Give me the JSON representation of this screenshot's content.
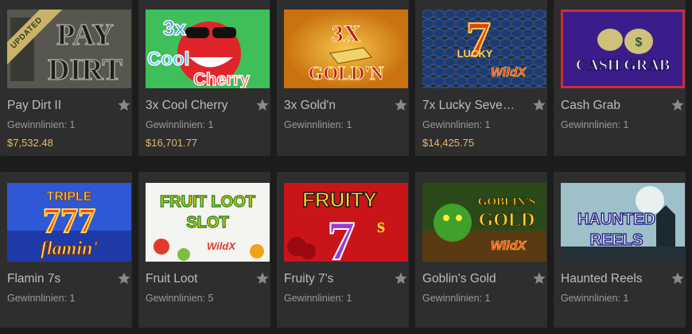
{
  "games": [
    {
      "id": "pay-dirt-ii",
      "title": "Pay Dirt II",
      "lines": "Gewinnlinien: 1",
      "jackpot": "$7,532.48",
      "badge": "UPDATED",
      "art_text": [
        "PAY",
        "DIRT"
      ]
    },
    {
      "id": "3x-cool-cherry",
      "title": "3x Cool Cherry",
      "lines": "Gewinnlinien: 1",
      "jackpot": "$16,701.77",
      "art_text": [
        "3x",
        "Cool",
        "Cherry"
      ]
    },
    {
      "id": "3x-goldn",
      "title": "3x Gold'n",
      "lines": "Gewinnlinien: 1",
      "jackpot": "",
      "art_text": [
        "3X",
        "GOLD'N"
      ]
    },
    {
      "id": "7x-lucky-sevens",
      "title": "7x Lucky Seve…",
      "lines": "Gewinnlinien: 1",
      "jackpot": "$14,425.75",
      "art_text": [
        "7",
        "LUCKY",
        "WildX"
      ]
    },
    {
      "id": "cash-grab",
      "title": "Cash Grab",
      "lines": "Gewinnlinien: 1",
      "jackpot": "",
      "art_text": [
        "CASH GRAB"
      ]
    },
    {
      "id": "flamin-7s",
      "title": "Flamin 7s",
      "lines": "Gewinnlinien: 1",
      "jackpot": "",
      "art_text": [
        "TRIPLE",
        "777",
        "flamin'"
      ]
    },
    {
      "id": "fruit-loot",
      "title": "Fruit Loot",
      "lines": "Gewinnlinien: 5",
      "jackpot": "",
      "art_text": [
        "FRUIT LOOT",
        "SLOT",
        "WildX"
      ]
    },
    {
      "id": "fruity-7s",
      "title": "Fruity 7's",
      "lines": "Gewinnlinien: 1",
      "jackpot": "",
      "art_text": [
        "FRUITY",
        "7",
        "s"
      ]
    },
    {
      "id": "goblins-gold",
      "title": "Goblin's Gold",
      "lines": "Gewinnlinien: 1",
      "jackpot": "",
      "art_text": [
        "GOBLIN'S",
        "GOLD",
        "WildX"
      ]
    },
    {
      "id": "haunted-reels",
      "title": "Haunted Reels",
      "lines": "Gewinnlinien: 1",
      "jackpot": "",
      "art_text": [
        "HAUNTED",
        "REELS"
      ]
    }
  ],
  "icons": {
    "favorite": "star-icon"
  },
  "colors": {
    "background": "#1c1c1c",
    "card": "#2e2e2e",
    "title": "#bdbdbd",
    "meta": "#9a9a9a",
    "jackpot": "#e8b96a",
    "star": "#8a8a8a"
  }
}
